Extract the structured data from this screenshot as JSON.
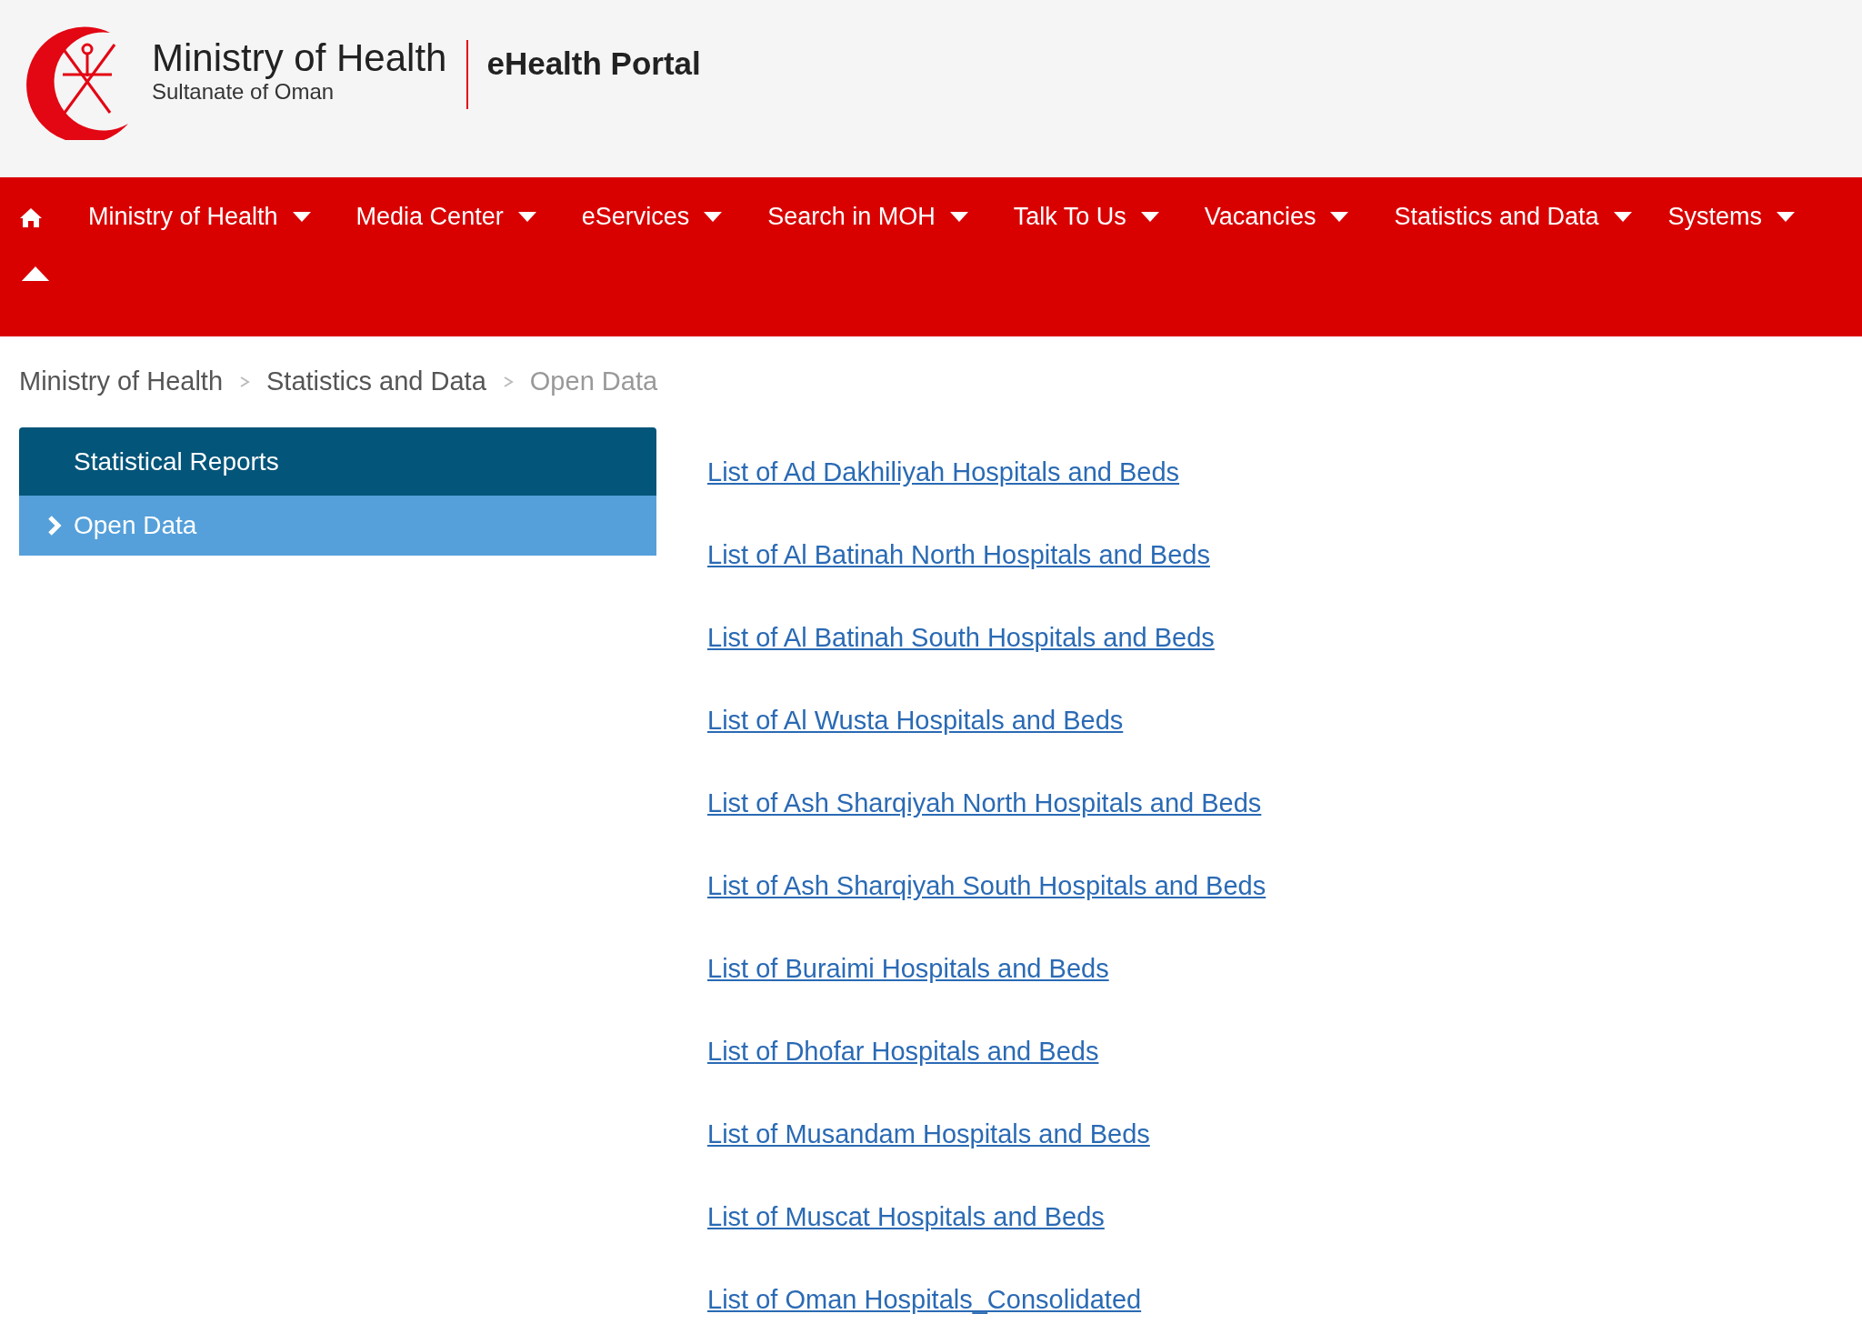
{
  "header": {
    "title": "Ministry of Health",
    "subtitle": "Sultanate of Oman",
    "portal": "eHealth Portal"
  },
  "nav": {
    "items": [
      {
        "label": "Ministry of Health"
      },
      {
        "label": "Media Center"
      },
      {
        "label": "eServices"
      },
      {
        "label": "Search in MOH"
      },
      {
        "label": "Talk To Us"
      },
      {
        "label": "Vacancies"
      },
      {
        "label": "Statistics and Data"
      },
      {
        "label": "Systems"
      }
    ]
  },
  "breadcrumb": [
    "Ministry of Health",
    "Statistics and Data",
    "Open Data"
  ],
  "sidebar": {
    "title": "Statistical Reports",
    "items": [
      {
        "label": "Open Data",
        "selected": true
      }
    ]
  },
  "links": [
    "List of Ad Dakhiliyah Hospitals and Beds",
    "List of Al Batinah North Hospitals and Beds",
    "List of Al Batinah South Hospitals and Beds",
    "List of Al Wusta Hospitals and Beds",
    "List of Ash Sharqiyah North Hospitals and Beds",
    "List of Ash Sharqiyah South Hospitals and Beds",
    "List of Buraimi Hospitals and Beds",
    "List of Dhofar Hospitals and Beds",
    "List of Musandam Hospitals and Beds",
    "List of Muscat Hospitals and Beds",
    "List of Oman Hospitals_Consolidated"
  ]
}
